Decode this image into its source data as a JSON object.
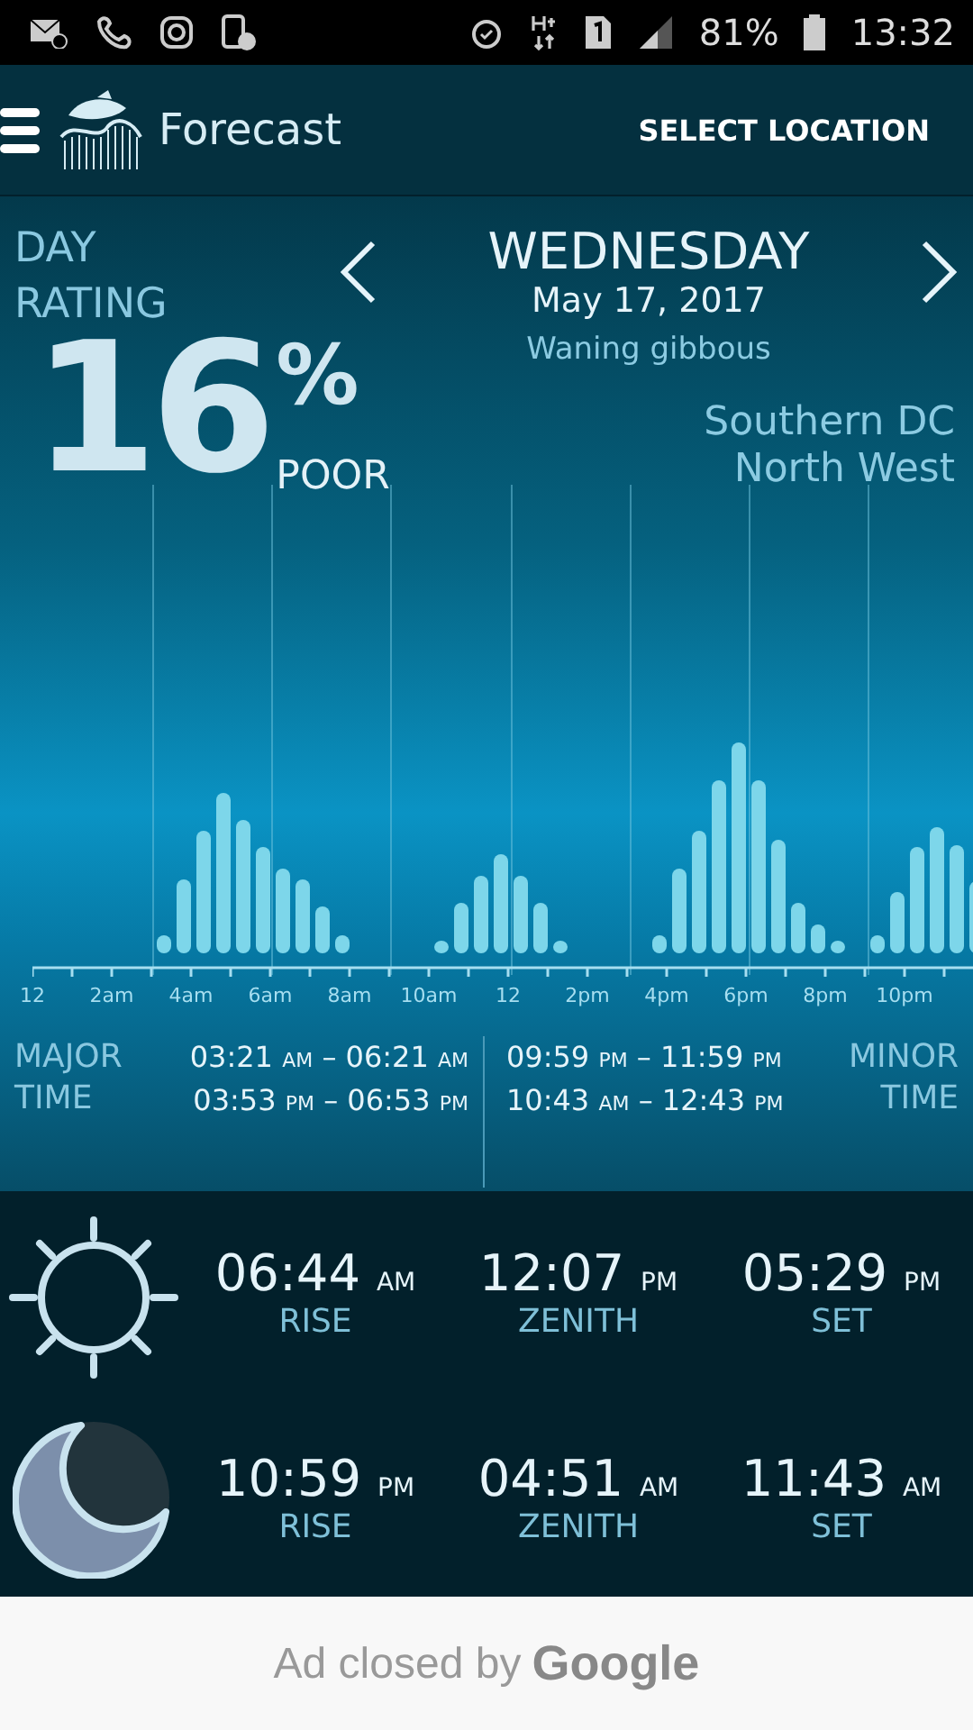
{
  "status_bar": {
    "battery": "81%",
    "time": "13:32"
  },
  "app_bar": {
    "title": "Forecast",
    "action": "SELECT LOCATION"
  },
  "day_rating": {
    "label": "DAY RATING",
    "value": "16",
    "unit": "%",
    "verdict": "POOR"
  },
  "day": {
    "name": "WEDNESDAY",
    "date": "May 17, 2017",
    "moon_phase": "Waning gibbous"
  },
  "location": {
    "lines": [
      "Southern DC",
      "North West"
    ]
  },
  "chart": {
    "axis_labels": [
      "12",
      "2am",
      "4am",
      "6am",
      "8am",
      "10am",
      "12",
      "2pm",
      "4pm",
      "6pm",
      "8pm",
      "10pm"
    ]
  },
  "major_times": {
    "label": "MAJOR TIME",
    "periods": [
      {
        "start": "03:21",
        "start_suffix": "AM",
        "separator": "–",
        "end": "06:21",
        "end_suffix": "AM"
      },
      {
        "start": "03:53",
        "start_suffix": "PM",
        "separator": "–",
        "end": "06:53",
        "end_suffix": "PM"
      }
    ]
  },
  "minor_times": {
    "label": "MINOR TIME",
    "periods": [
      {
        "start": "09:59",
        "start_suffix": "PM",
        "separator": "–",
        "end": "11:59",
        "end_suffix": "PM"
      },
      {
        "start": "10:43",
        "start_suffix": "AM",
        "separator": "–",
        "end": "12:43",
        "end_suffix": "PM"
      }
    ]
  },
  "celestial": [
    {
      "kind": "sun",
      "events": [
        {
          "time": "06:44",
          "suffix": "AM",
          "label": "RISE"
        },
        {
          "time": "12:07",
          "suffix": "PM",
          "label": "ZENITH"
        },
        {
          "time": "05:29",
          "suffix": "PM",
          "label": "SET"
        }
      ]
    },
    {
      "kind": "moon",
      "events": [
        {
          "time": "10:59",
          "suffix": "PM",
          "label": "RISE"
        },
        {
          "time": "04:51",
          "suffix": "AM",
          "label": "ZENITH"
        },
        {
          "time": "11:43",
          "suffix": "AM",
          "label": "SET"
        }
      ]
    }
  ],
  "ad": {
    "text": "Ad closed by",
    "brand": "Google"
  }
}
